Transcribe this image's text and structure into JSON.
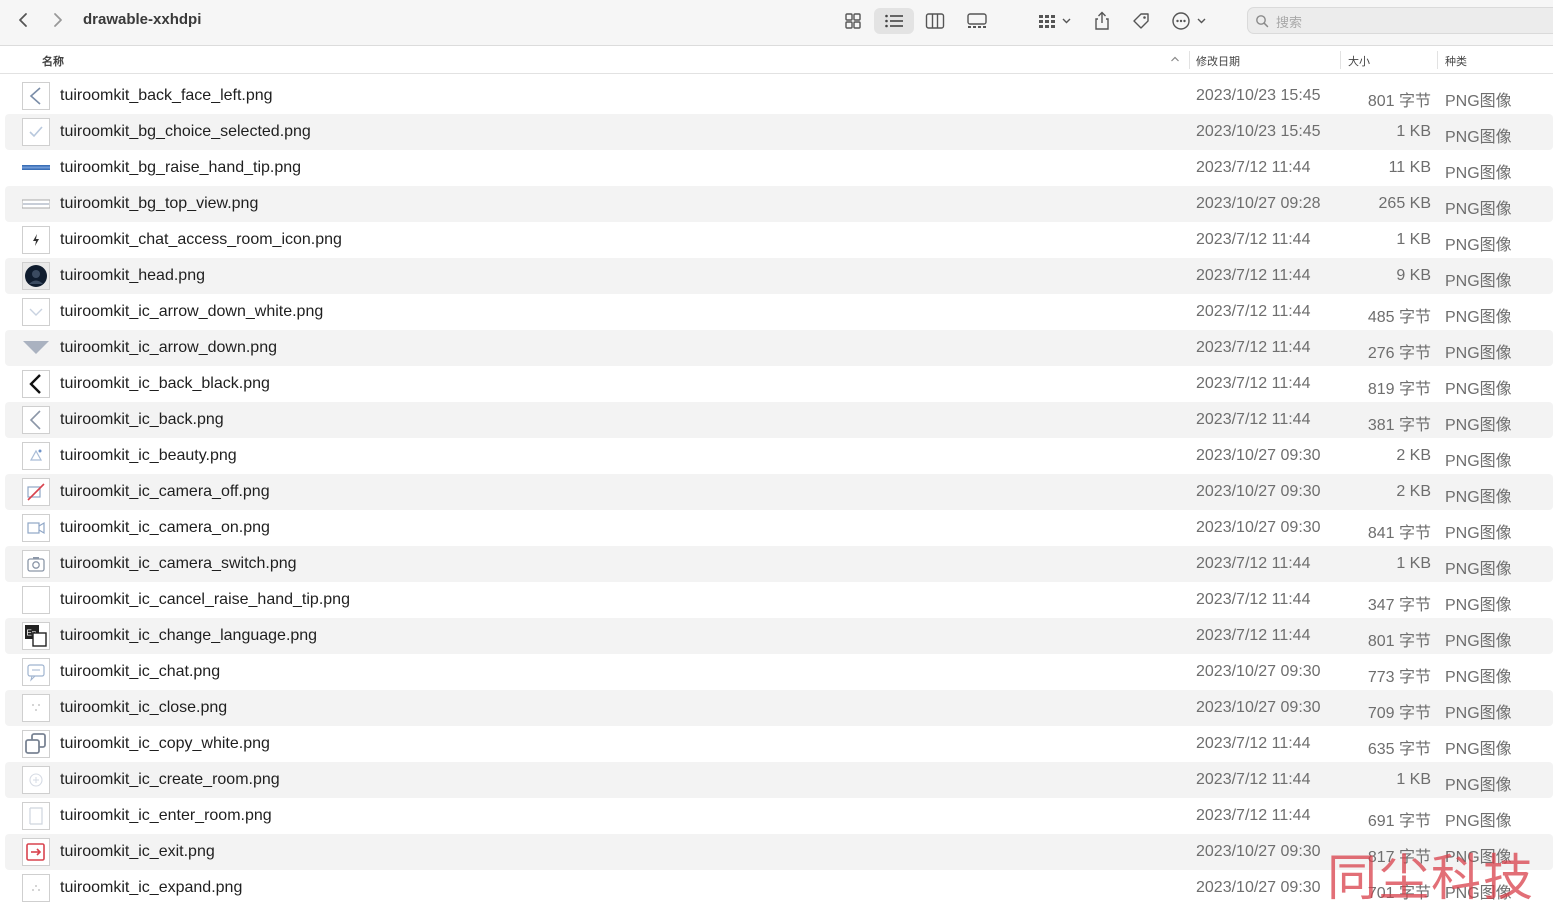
{
  "toolbar": {
    "title": "drawable-xxhdpi",
    "back_icon": "chevron-left-icon",
    "forward_icon": "chevron-right-icon",
    "view_icons": [
      "icon-grid-view-icon",
      "list-view-icon",
      "column-view-icon",
      "gallery-view-icon"
    ],
    "group_icon": "group-by-icon",
    "share_icon": "share-icon",
    "tag_icon": "tag-icon",
    "more_icon": "more-actions-icon",
    "search_placeholder": "搜索"
  },
  "columns": {
    "name": "名称",
    "date": "修改日期",
    "size": "大小",
    "kind": "种类"
  },
  "files": [
    {
      "name": "tuiroomkit_back_face_left.png",
      "date": "2023/10/23 15:45",
      "size": "801 字节",
      "kind": "PNG图像"
    },
    {
      "name": "tuiroomkit_bg_choice_selected.png",
      "date": "2023/10/23 15:45",
      "size": "1 KB",
      "kind": "PNG图像"
    },
    {
      "name": "tuiroomkit_bg_raise_hand_tip.png",
      "date": "2023/7/12 11:44",
      "size": "11 KB",
      "kind": "PNG图像"
    },
    {
      "name": "tuiroomkit_bg_top_view.png",
      "date": "2023/10/27 09:28",
      "size": "265 KB",
      "kind": "PNG图像"
    },
    {
      "name": "tuiroomkit_chat_access_room_icon.png",
      "date": "2023/7/12 11:44",
      "size": "1 KB",
      "kind": "PNG图像"
    },
    {
      "name": "tuiroomkit_head.png",
      "date": "2023/7/12 11:44",
      "size": "9 KB",
      "kind": "PNG图像"
    },
    {
      "name": "tuiroomkit_ic_arrow_down_white.png",
      "date": "2023/7/12 11:44",
      "size": "485 字节",
      "kind": "PNG图像"
    },
    {
      "name": "tuiroomkit_ic_arrow_down.png",
      "date": "2023/7/12 11:44",
      "size": "276 字节",
      "kind": "PNG图像"
    },
    {
      "name": "tuiroomkit_ic_back_black.png",
      "date": "2023/7/12 11:44",
      "size": "819 字节",
      "kind": "PNG图像"
    },
    {
      "name": "tuiroomkit_ic_back.png",
      "date": "2023/7/12 11:44",
      "size": "381 字节",
      "kind": "PNG图像"
    },
    {
      "name": "tuiroomkit_ic_beauty.png",
      "date": "2023/10/27 09:30",
      "size": "2 KB",
      "kind": "PNG图像"
    },
    {
      "name": "tuiroomkit_ic_camera_off.png",
      "date": "2023/10/27 09:30",
      "size": "2 KB",
      "kind": "PNG图像"
    },
    {
      "name": "tuiroomkit_ic_camera_on.png",
      "date": "2023/10/27 09:30",
      "size": "841 字节",
      "kind": "PNG图像"
    },
    {
      "name": "tuiroomkit_ic_camera_switch.png",
      "date": "2023/7/12 11:44",
      "size": "1 KB",
      "kind": "PNG图像"
    },
    {
      "name": "tuiroomkit_ic_cancel_raise_hand_tip.png",
      "date": "2023/7/12 11:44",
      "size": "347 字节",
      "kind": "PNG图像"
    },
    {
      "name": "tuiroomkit_ic_change_language.png",
      "date": "2023/7/12 11:44",
      "size": "801 字节",
      "kind": "PNG图像"
    },
    {
      "name": "tuiroomkit_ic_chat.png",
      "date": "2023/10/27 09:30",
      "size": "773 字节",
      "kind": "PNG图像"
    },
    {
      "name": "tuiroomkit_ic_close.png",
      "date": "2023/10/27 09:30",
      "size": "709 字节",
      "kind": "PNG图像"
    },
    {
      "name": "tuiroomkit_ic_copy_white.png",
      "date": "2023/7/12 11:44",
      "size": "635 字节",
      "kind": "PNG图像"
    },
    {
      "name": "tuiroomkit_ic_create_room.png",
      "date": "2023/7/12 11:44",
      "size": "1 KB",
      "kind": "PNG图像"
    },
    {
      "name": "tuiroomkit_ic_enter_room.png",
      "date": "2023/7/12 11:44",
      "size": "691 字节",
      "kind": "PNG图像"
    },
    {
      "name": "tuiroomkit_ic_exit.png",
      "date": "2023/10/27 09:30",
      "size": "817 字节",
      "kind": "PNG图像"
    },
    {
      "name": "tuiroomkit_ic_expand.png",
      "date": "2023/10/27 09:30",
      "size": "701 字节",
      "kind": "PNG图像"
    }
  ],
  "thumb_icons": [
    "back-chevron-thumb-icon",
    "checkmark-thumb-icon",
    "blue-bar-thumb-icon",
    "gray-bar-thumb-icon",
    "bolt-thumb-icon",
    "avatar-thumb-icon",
    "arrow-down-thumb-icon",
    "triangle-down-thumb-icon",
    "back-black-thumb-icon",
    "back-thumb-icon",
    "beauty-thumb-icon",
    "camera-off-thumb-icon",
    "camera-on-thumb-icon",
    "camera-switch-thumb-icon",
    "blank-thumb-icon",
    "language-thumb-icon",
    "chat-thumb-icon",
    "close-thumb-icon",
    "copy-thumb-icon",
    "create-room-thumb-icon",
    "enter-room-thumb-icon",
    "exit-thumb-icon",
    "expand-thumb-icon"
  ],
  "watermark": "同尘科技",
  "colors": {
    "toolbar_bg": "#f6f6f6",
    "row_alt": "#f3f3f3",
    "watermark": "#d9404a"
  }
}
